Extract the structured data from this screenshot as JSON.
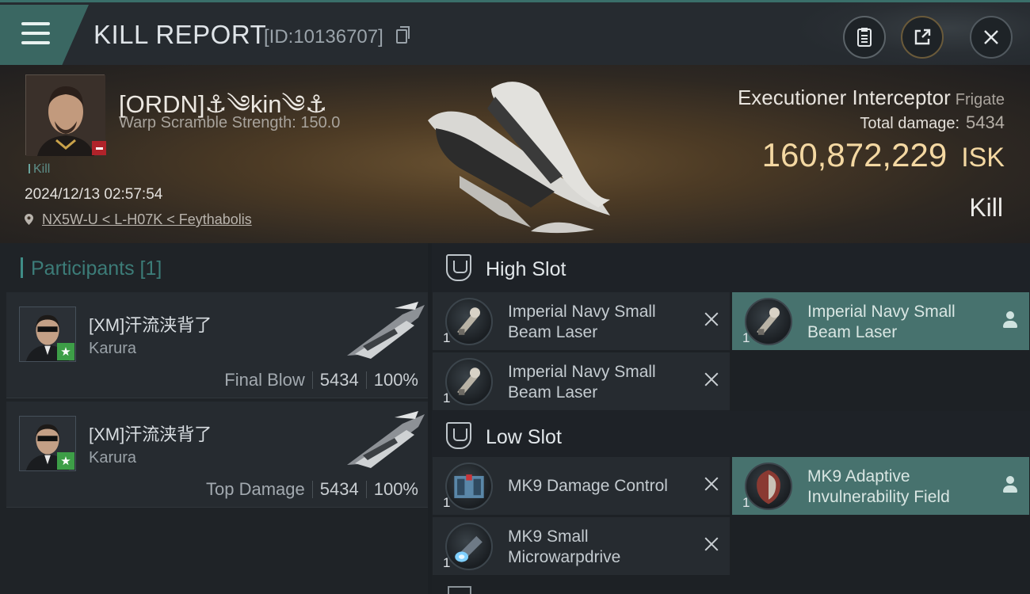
{
  "header": {
    "title": "KILL REPORT",
    "report_id": "[ID:10136707]"
  },
  "victim": {
    "pilot_name": "[ORDN]⚓༄kin༄⚓",
    "warp_scramble": "Warp Scramble Strength: 150.0",
    "tag": "Kill",
    "datetime": "2024/12/13 02:57:54",
    "location": "NX5W-U < L-H07K < Feythabolis",
    "ship_name": "Executioner Interceptor",
    "ship_class": "Frigate",
    "total_damage_label": "Total damage:",
    "total_damage": "5434",
    "isk_value": "160,872,229",
    "isk_unit": "ISK",
    "result": "Kill"
  },
  "participants": {
    "header": "Participants [1]",
    "rows": [
      {
        "name": "[XM]汗流浃背了",
        "ship": "Karura",
        "role": "Final Blow",
        "damage": "5434",
        "percent": "100%"
      },
      {
        "name": "[XM]汗流浃背了",
        "ship": "Karura",
        "role": "Top Damage",
        "damage": "5434",
        "percent": "100%"
      }
    ]
  },
  "fitting": {
    "high_slot": {
      "title": "High Slot",
      "modules": [
        {
          "name": "Imperial Navy Small Beam Laser",
          "qty": "1",
          "status": "destroyed"
        },
        {
          "name": "Imperial Navy Small Beam Laser",
          "qty": "1",
          "status": "dropped"
        },
        {
          "name": "Imperial Navy Small Beam Laser",
          "qty": "1",
          "status": "destroyed"
        }
      ]
    },
    "low_slot": {
      "title": "Low Slot",
      "modules": [
        {
          "name": "MK9 Damage Control",
          "qty": "1",
          "status": "destroyed"
        },
        {
          "name": "MK9 Adaptive Invulnerability Field",
          "qty": "1",
          "status": "dropped"
        },
        {
          "name": "MK9 Small Microwarpdrive",
          "qty": "1",
          "status": "destroyed"
        }
      ]
    }
  },
  "colors": {
    "accent_teal": "#47726e",
    "isk_gold": "#f4d8a2",
    "badge_red": "#b0232a",
    "badge_green": "#3d9e47"
  },
  "icons": [
    "menu-icon",
    "copy-icon",
    "clipboard-icon",
    "share-icon",
    "close-icon",
    "location-pin-icon",
    "high-slot-icon",
    "low-slot-icon",
    "remove-icon",
    "person-icon",
    "star-icon",
    "minus-icon"
  ]
}
